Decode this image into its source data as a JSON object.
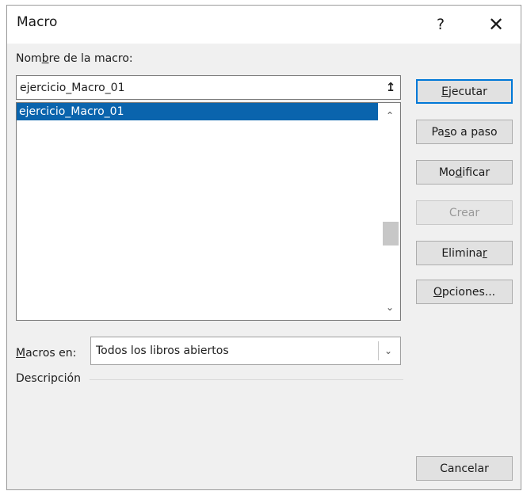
{
  "window": {
    "title": "Macro",
    "help_label": "?",
    "close_label": "✕"
  },
  "name_field": {
    "label_pre": "Nom",
    "label_accel": "b",
    "label_post": "re de la macro:",
    "value": "ejercicio_Macro_01",
    "upload_icon": "↥"
  },
  "macro_list": {
    "items": [
      "ejercicio_Macro_01"
    ],
    "selected_index": 0,
    "scroll_up": "⌃",
    "scroll_down": "⌄"
  },
  "buttons": {
    "ejecutar": {
      "accel": "E",
      "rest": "jecutar"
    },
    "paso": {
      "pre": "Pa",
      "accel": "s",
      "post": "o a paso"
    },
    "modificar": {
      "pre": "Mo",
      "accel": "d",
      "post": "ificar"
    },
    "crear": {
      "label": "Crear"
    },
    "eliminar": {
      "pre": "Elimina",
      "accel": "r"
    },
    "opciones": {
      "accel": "O",
      "rest": "pciones..."
    },
    "cancelar": {
      "label": "Cancelar"
    }
  },
  "macros_en": {
    "label_accel": "M",
    "label_rest": "acros en:",
    "value": "Todos los libros abiertos",
    "chevron": "⌄"
  },
  "description": {
    "label": "Descripción"
  },
  "colors": {
    "selection": "#0a64ad",
    "default_button_border": "#0078d7"
  }
}
